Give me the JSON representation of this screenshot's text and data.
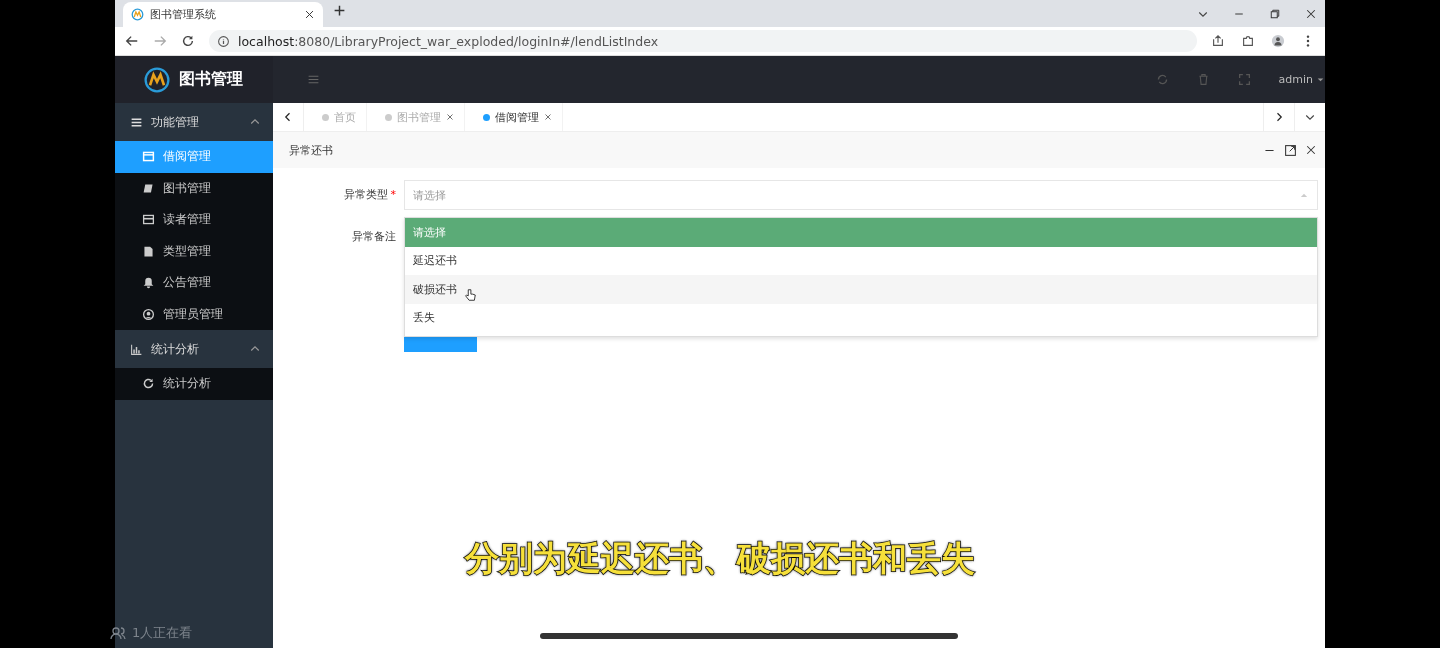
{
  "browser": {
    "tab_title": "图书管理系统",
    "url": "**localhost**:8080/LibraryProject_war_exploded/loginIn#/lendListIndex"
  },
  "app": {
    "logo_text": "图书管理",
    "user": "admin"
  },
  "sidebar": [
    {
      "label": "功能管理",
      "expanded": true,
      "items": [
        {
          "label": "借阅管理",
          "selected": true
        },
        {
          "label": "图书管理",
          "selected": false
        },
        {
          "label": "读者管理",
          "selected": false
        },
        {
          "label": "类型管理",
          "selected": false
        },
        {
          "label": "公告管理",
          "selected": false
        },
        {
          "label": "管理员管理",
          "selected": false
        }
      ]
    },
    {
      "label": "统计分析",
      "expanded": true,
      "items": [
        {
          "label": "统计分析",
          "selected": false
        }
      ]
    }
  ],
  "tabs": [
    {
      "label": "首页",
      "selected": false,
      "closable": false
    },
    {
      "label": "图书管理",
      "selected": false,
      "closable": true
    },
    {
      "label": "借阅管理",
      "selected": true,
      "closable": true
    }
  ],
  "panel": {
    "title": "异常还书"
  },
  "form": {
    "fields": [
      {
        "kind": "select",
        "label": "异常类型",
        "required_mark": "*",
        "placeholder": "请选择",
        "expanded": true,
        "options": [
          {
            "label": "请选择",
            "selected": true,
            "hovered": false
          },
          {
            "label": "延迟还书",
            "selected": false,
            "hovered": false
          },
          {
            "label": "破损还书",
            "selected": false,
            "hovered": true
          },
          {
            "label": "丢失",
            "selected": false,
            "hovered": false
          }
        ]
      },
      {
        "kind": "textarea",
        "label": "异常备注"
      }
    ]
  },
  "overlay": {
    "caption": "分别为延迟还书、破损还书和丢失",
    "viewers": "1人正在看"
  }
}
